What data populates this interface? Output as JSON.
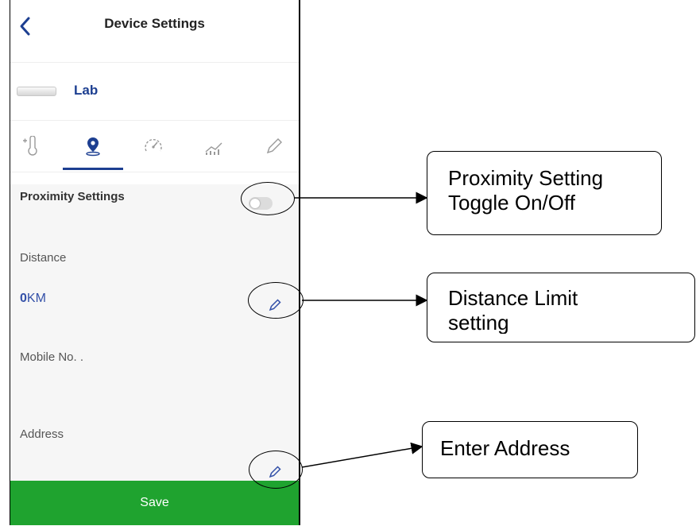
{
  "header": {
    "title": "Device Settings"
  },
  "device": {
    "name": "Lab"
  },
  "tabs": [
    {
      "id": "temperature",
      "icon": "thermometer-icon",
      "active": false
    },
    {
      "id": "location",
      "icon": "location-pin-icon",
      "active": true
    },
    {
      "id": "speed",
      "icon": "gauge-icon",
      "active": false
    },
    {
      "id": "statistics",
      "icon": "chart-icon",
      "active": false
    },
    {
      "id": "edit",
      "icon": "pencil-icon",
      "active": false
    }
  ],
  "proximity": {
    "title": "Proximity Settings",
    "toggle_on": false,
    "distance_label": "Distance",
    "distance_value": "0",
    "distance_unit": "KM",
    "mobile_label": "Mobile No. .",
    "address_label": "Address"
  },
  "footer": {
    "save_label": "Save"
  },
  "annotations": {
    "toggle_callout": [
      "Proximity Setting",
      "Toggle On/Off"
    ],
    "distance_callout": [
      "Distance Limit",
      "setting"
    ],
    "address_callout": "Enter Address"
  },
  "colors": {
    "accent": "#1d3f91",
    "save": "#1fa32f"
  }
}
